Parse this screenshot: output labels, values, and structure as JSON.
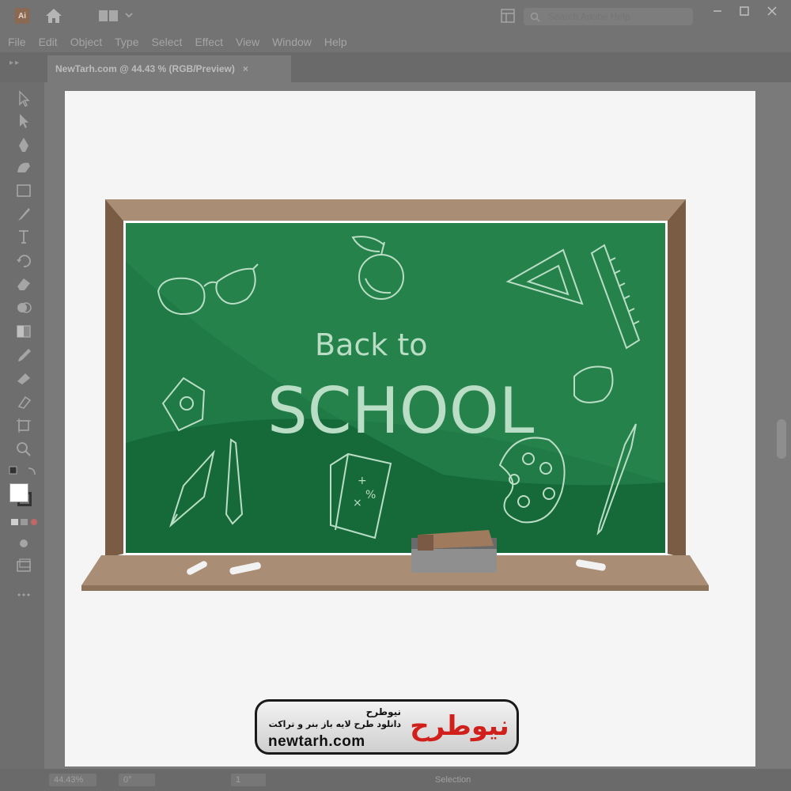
{
  "app": {
    "logo_text": "Ai",
    "search": {
      "placeholder": "Search Adobe Help"
    }
  },
  "menu": {
    "items": [
      "File",
      "Edit",
      "Object",
      "Type",
      "Select",
      "Effect",
      "View",
      "Window",
      "Help"
    ]
  },
  "document": {
    "tab_title": "NewTarh.com @ 44.43 % (RGB/Preview)",
    "tab_close": "×"
  },
  "status": {
    "zoom": "44.43%",
    "rotation": "0°",
    "artboard": "1",
    "tool": "Selection"
  },
  "board": {
    "line1": "Back to",
    "line2": "SCHOOL",
    "colors": {
      "frame": "#a98d74",
      "frame_dark": "#7a5c44",
      "green": "#1f7a45",
      "green_dark": "#166a3a",
      "chalk": "#b9ddc5"
    }
  },
  "watermark": {
    "brand_fa": "نیوطرح",
    "tagline_fa": "دانلود طرح لایه باز بنر و تراکت",
    "site": "newtarh.com",
    "logo_fa": "نیوطرح"
  },
  "icons": {
    "toolbar": [
      "selection-tool-icon",
      "direct-selection-tool-icon",
      "pen-tool-icon",
      "curvature-tool-icon",
      "rectangle-tool-icon",
      "paintbrush-tool-icon",
      "type-tool-icon",
      "rotate-tool-icon",
      "eraser-tool-icon",
      "shape-builder-tool-icon",
      "gradient-tool-icon",
      "eyedropper-tool-icon",
      "blend-tool-icon",
      "symbol-sprayer-tool-icon",
      "artboard-tool-icon",
      "zoom-tool-icon"
    ]
  }
}
